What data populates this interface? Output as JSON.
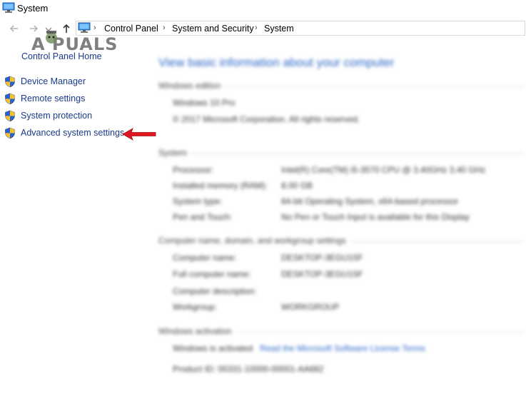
{
  "window": {
    "title": "System"
  },
  "breadcrumb": [
    "Control Panel",
    "System and Security",
    "System"
  ],
  "watermark": "A PUALS",
  "left_pane": {
    "home_link": "Control Panel Home",
    "tasks": [
      {
        "label": "Device Manager"
      },
      {
        "label": "Remote settings"
      },
      {
        "label": "System protection"
      },
      {
        "label": "Advanced system settings"
      }
    ]
  },
  "main": {
    "heading": "View basic information about your computer",
    "edition": {
      "section": "Windows edition",
      "name": "Windows 10 Pro",
      "copyright": "© 2017 Microsoft Corporation. All rights reserved."
    },
    "system": {
      "section": "System",
      "rows": [
        {
          "label": "Processor:",
          "value": "Intel(R) Core(TM) i5-3570 CPU @ 3.40GHz   3.40 GHz"
        },
        {
          "label": "Installed memory (RAM):",
          "value": "8.00 GB"
        },
        {
          "label": "System type:",
          "value": "64-bit Operating System, x64-based processor"
        },
        {
          "label": "Pen and Touch:",
          "value": "No Pen or Touch Input is available for this Display"
        }
      ]
    },
    "computer": {
      "section": "Computer name, domain, and workgroup settings",
      "rows": [
        {
          "label": "Computer name:",
          "value": "DESKTOP-3EGU15F"
        },
        {
          "label": "Full computer name:",
          "value": "DESKTOP-3EGU15F"
        },
        {
          "label": "Computer description:",
          "value": ""
        },
        {
          "label": "Workgroup:",
          "value": "WORKGROUP"
        }
      ]
    },
    "activation": {
      "section": "Windows activation",
      "status": "Windows is activated",
      "link": "Read the Microsoft Software License Terms",
      "product_id": "Product ID: 00331-10000-00001-AA682"
    }
  },
  "colors": {
    "link": "#1a3a8a",
    "heading": "#2a64c4",
    "arrow": "#e0171f"
  }
}
